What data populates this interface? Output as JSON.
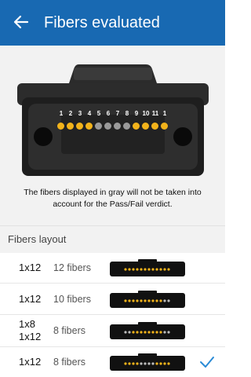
{
  "header": {
    "title": "Fibers evaluated",
    "back_icon": "arrow-left-icon",
    "bg_color": "#1869b2"
  },
  "connector": {
    "fiber_numbers": [
      "1",
      "2",
      "3",
      "4",
      "5",
      "6",
      "7",
      "8",
      "9",
      "10",
      "11",
      "1"
    ],
    "fiber_states": [
      "active",
      "active",
      "active",
      "active",
      "inactive",
      "inactive",
      "inactive",
      "inactive",
      "active",
      "active",
      "active",
      "active"
    ],
    "active_color": "#f2b31b",
    "inactive_color": "#9a9a9a"
  },
  "note": "The fibers displayed in gray will not be taken into account for the Pass/Fail verdict.",
  "section": {
    "label": "Fibers layout"
  },
  "layouts": [
    {
      "mode": "1x12",
      "count": "12 fibers",
      "dots": [
        "o",
        "o",
        "o",
        "o",
        "o",
        "o",
        "o",
        "o",
        "o",
        "o",
        "o",
        "o"
      ],
      "selected": false
    },
    {
      "mode": "1x12",
      "count": "10 fibers",
      "dots": [
        "o",
        "o",
        "o",
        "o",
        "o",
        "o",
        "o",
        "o",
        "o",
        "o",
        "g",
        "g"
      ],
      "selected": false
    },
    {
      "mode": "1x8\n1x12",
      "count": "8 fibers",
      "dots": [
        "g",
        "g",
        "o",
        "o",
        "o",
        "o",
        "o",
        "o",
        "o",
        "o",
        "g",
        "g"
      ],
      "selected": false
    },
    {
      "mode": "1x12",
      "count": "8 fibers",
      "dots": [
        "o",
        "o",
        "o",
        "o",
        "g",
        "g",
        "g",
        "g",
        "o",
        "o",
        "o",
        "o"
      ],
      "selected": true
    }
  ],
  "check_color": "#2a8bd6"
}
